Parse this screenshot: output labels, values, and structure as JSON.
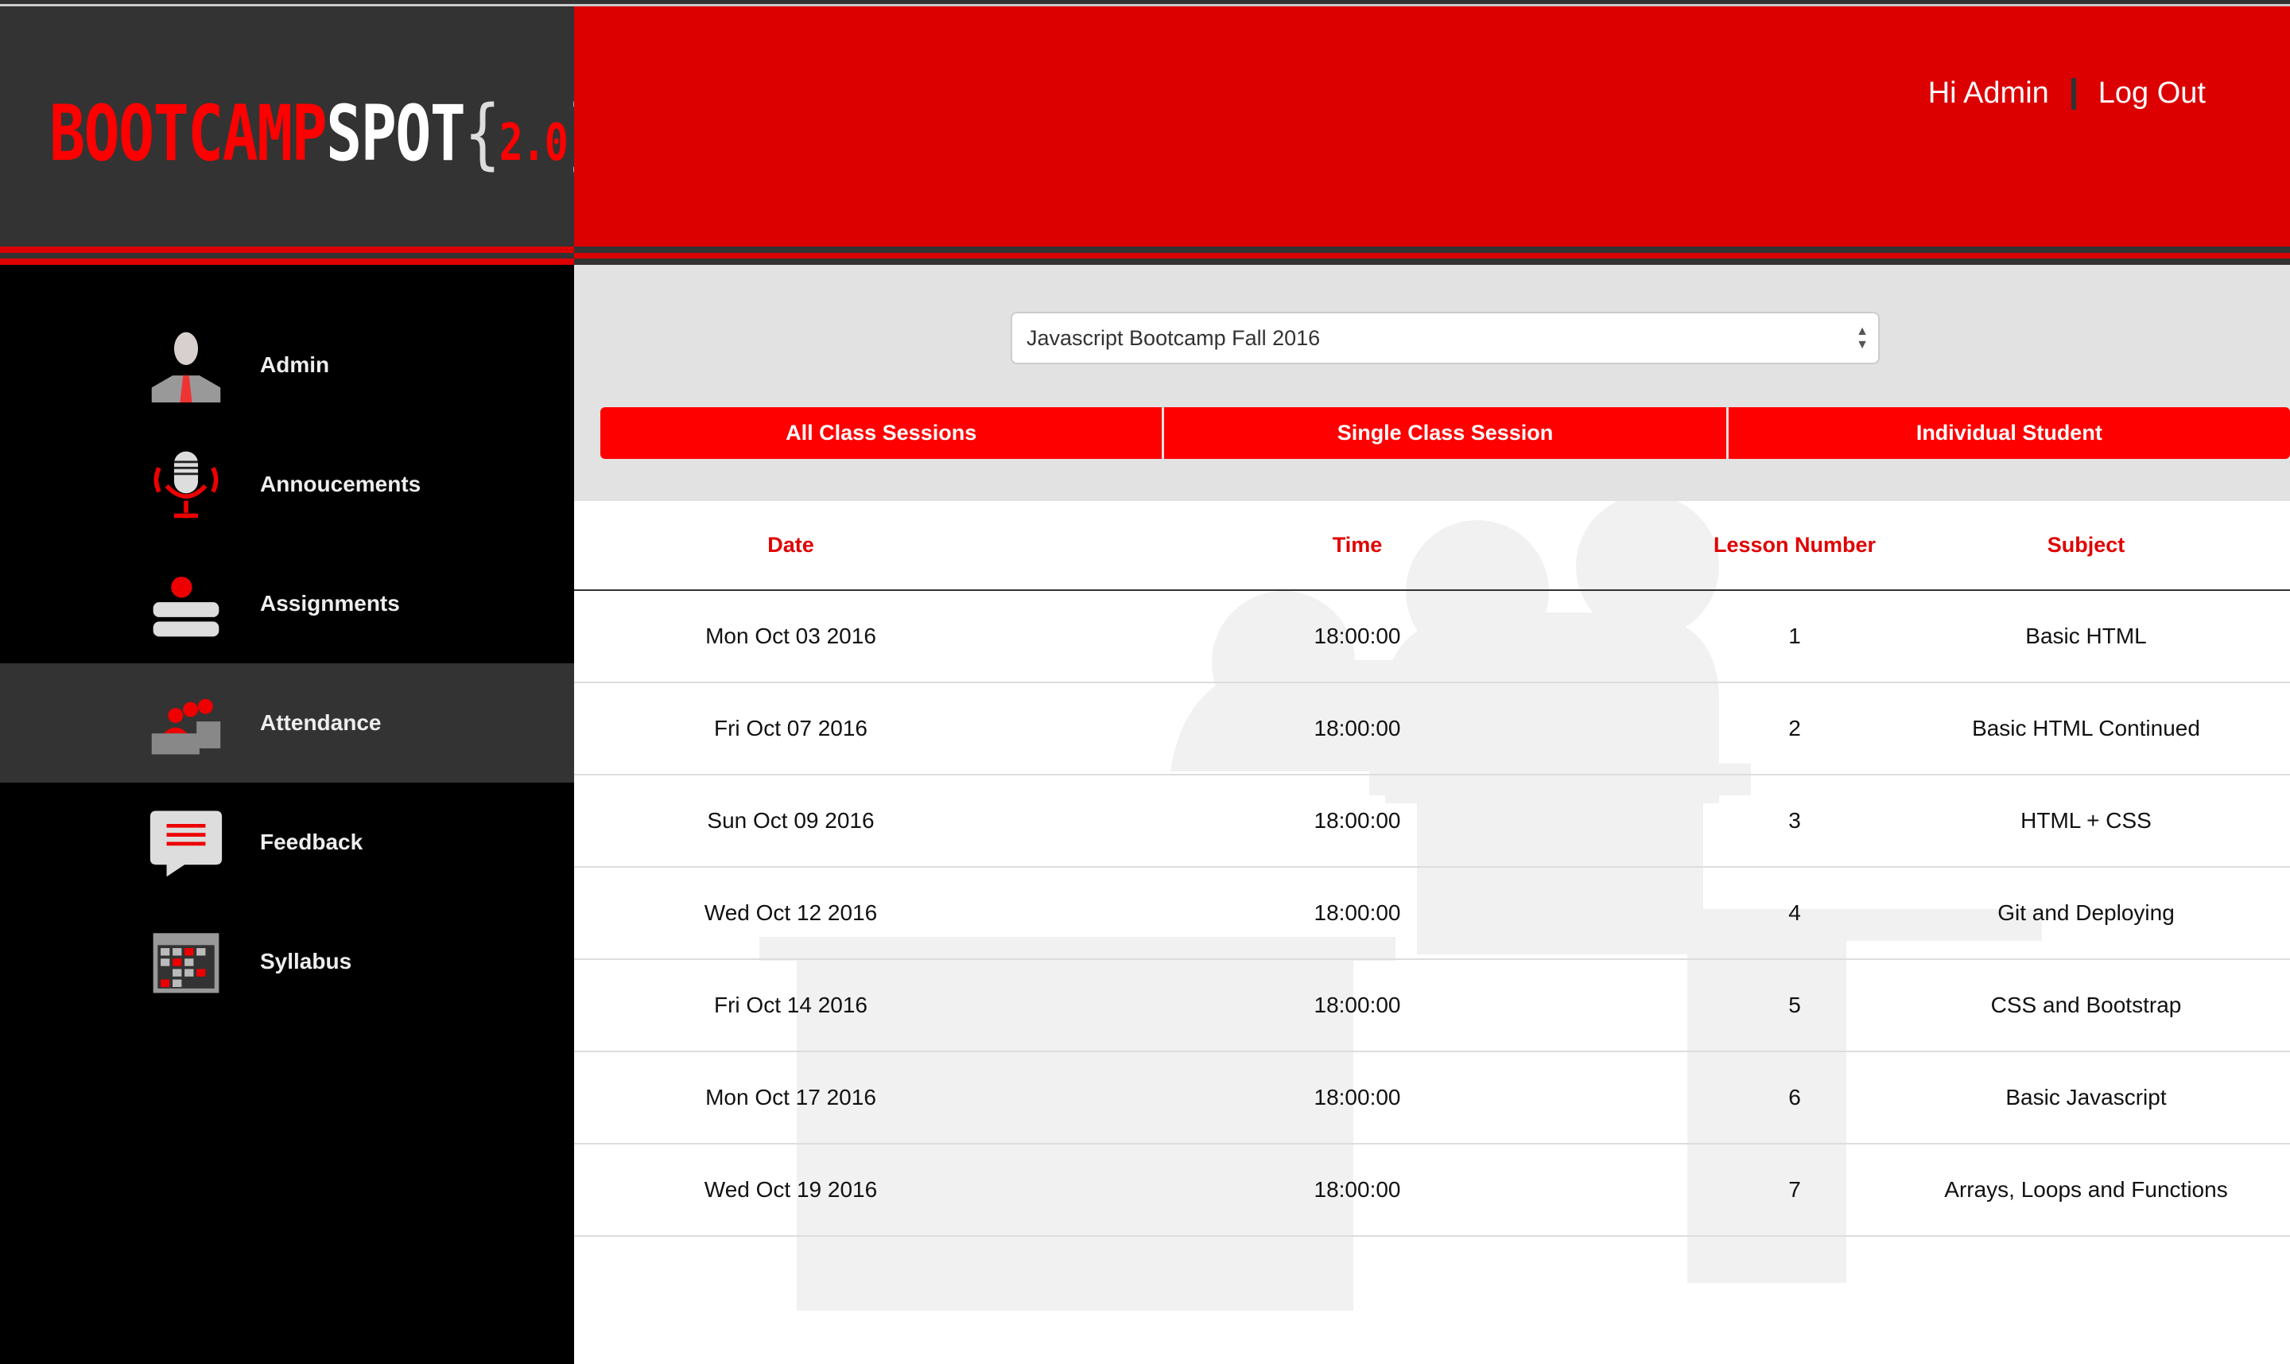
{
  "brand": {
    "part1": "BOOTCAMP",
    "part2": "SPOT",
    "version_open": "{",
    "version": "2.0",
    "version_close": "}"
  },
  "header": {
    "greeting": "Hi Admin",
    "logout": "Log Out"
  },
  "colors": {
    "brand_red": "#dc0000",
    "tab_red": "#ff0000",
    "sidebar": "#000000",
    "logo_bg": "#333333"
  },
  "sidebar": {
    "items": [
      {
        "label": "Admin",
        "icon": "admin-icon"
      },
      {
        "label": "Annoucements",
        "icon": "microphone-icon"
      },
      {
        "label": "Assignments",
        "icon": "books-apple-icon"
      },
      {
        "label": "Attendance",
        "icon": "classroom-icon",
        "active": true
      },
      {
        "label": "Feedback",
        "icon": "chat-bubble-icon"
      },
      {
        "label": "Syllabus",
        "icon": "calendar-icon"
      }
    ]
  },
  "main": {
    "course_select": "Javascript Bootcamp Fall 2016",
    "tabs": [
      "All Class Sessions",
      "Single Class Session",
      "Individual Student"
    ],
    "table": {
      "headers": [
        "Date",
        "Time",
        "Lesson Number",
        "Subject"
      ],
      "rows": [
        [
          "Mon Oct 03 2016",
          "18:00:00",
          "1",
          "Basic HTML"
        ],
        [
          "Fri Oct 07 2016",
          "18:00:00",
          "2",
          "Basic HTML Continued"
        ],
        [
          "Sun Oct 09 2016",
          "18:00:00",
          "3",
          "HTML + CSS"
        ],
        [
          "Wed Oct 12 2016",
          "18:00:00",
          "4",
          "Git and Deploying"
        ],
        [
          "Fri Oct 14 2016",
          "18:00:00",
          "5",
          "CSS and Bootstrap"
        ],
        [
          "Mon Oct 17 2016",
          "18:00:00",
          "6",
          "Basic Javascript"
        ],
        [
          "Wed Oct 19 2016",
          "18:00:00",
          "7",
          "Arrays, Loops and Functions"
        ]
      ]
    }
  }
}
